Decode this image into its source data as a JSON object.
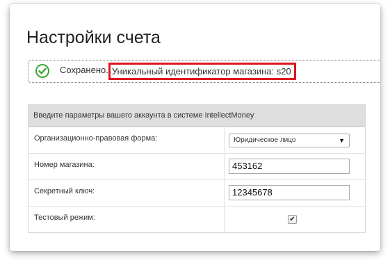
{
  "page": {
    "title": "Настройки счета"
  },
  "notice": {
    "icon": "check-circle-icon",
    "saved": "Сохранено.",
    "message": "Уникальный идентификатор магазина: s20",
    "highlight_color": "#e0141e",
    "icon_color": "#3aa836"
  },
  "form": {
    "header": "Введите параметры вашего аккаунта в системе IntellectMoney",
    "legal_form": {
      "label": "Организационно-правовая форма:",
      "selected": "Юридическое лицо"
    },
    "shop_number": {
      "label": "Номер магазина:",
      "value": "453162"
    },
    "secret_key": {
      "label": "Секретный ключ:",
      "value": "12345678"
    },
    "test_mode": {
      "label": "Тестовый режим:",
      "checked": true,
      "check_glyph": "✔"
    }
  }
}
